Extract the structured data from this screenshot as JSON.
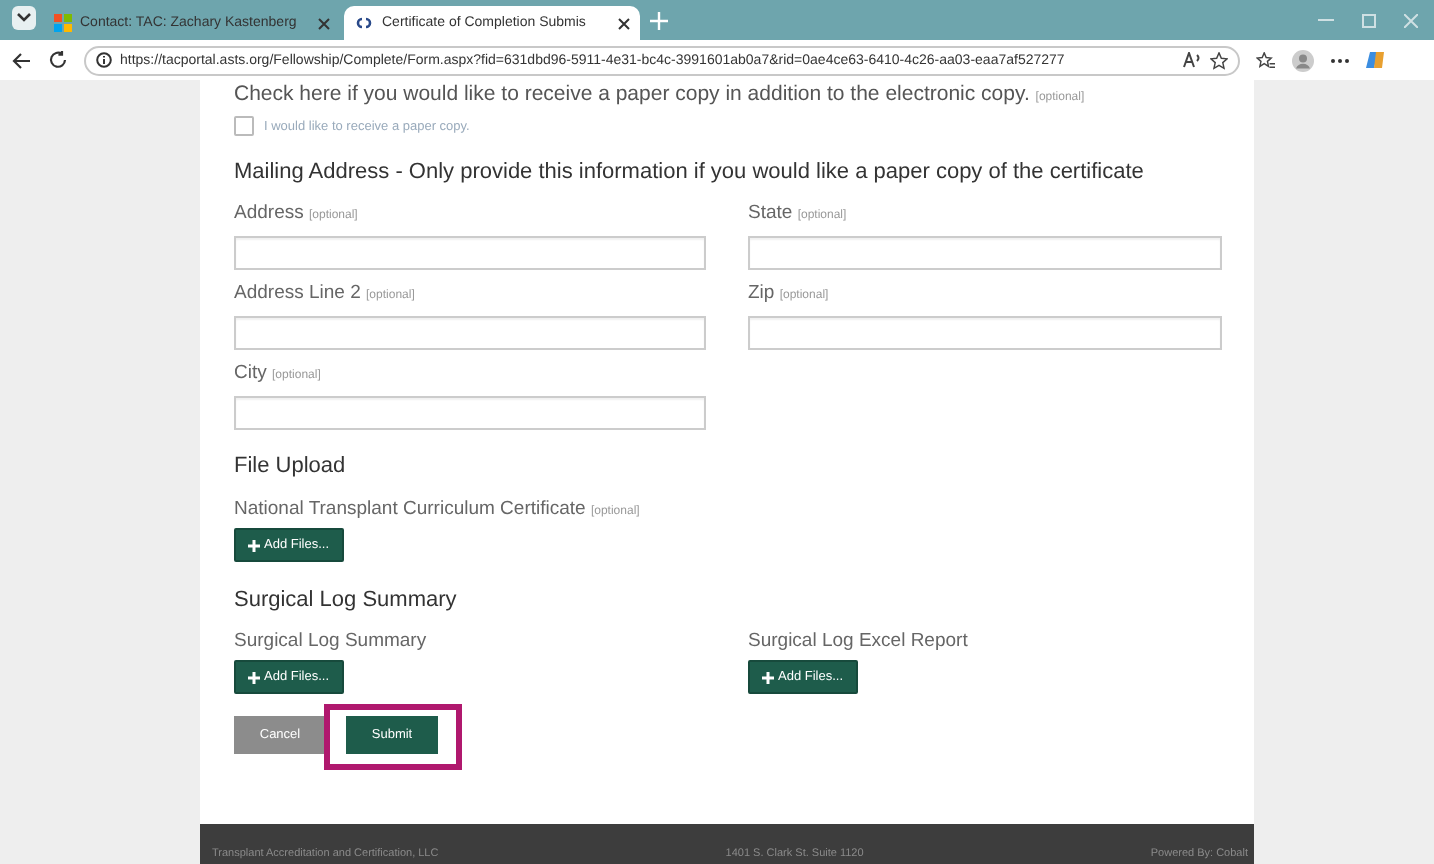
{
  "browser": {
    "tabs": [
      {
        "title": "Contact: TAC: Zachary Kastenberg",
        "selected": false
      },
      {
        "title": "Certificate of Completion Submis",
        "selected": true
      }
    ],
    "url": "https://tacportal.asts.org/Fellowship/Complete/Form.aspx?fid=631dbd96-5911-4e31-bc4c-3991601ab0a7&rid=0ae4ce63-6410-4c26-aa03-eaa7af527277"
  },
  "form": {
    "paper_copy": {
      "prompt": "Check here if you would like to receive a paper copy in addition to the electronic copy.",
      "optional": "[optional]",
      "checkbox_label": "I would like to receive a paper copy.",
      "checked": false
    },
    "mailing_heading": "Mailing Address - Only provide this information if you would like a paper copy of the certificate",
    "address_fields": [
      {
        "label": "Address",
        "optional": "[optional]"
      },
      {
        "label": "State",
        "optional": "[optional]"
      },
      {
        "label": "Address Line 2",
        "optional": "[optional]"
      },
      {
        "label": "Zip",
        "optional": "[optional]"
      },
      {
        "label": "City",
        "optional": "[optional]"
      }
    ],
    "file_upload": {
      "heading": "File Upload",
      "items": [
        {
          "label": "National Transplant Curriculum Certificate",
          "optional": "[optional]",
          "button": "Add Files..."
        }
      ]
    },
    "surgical_log": {
      "heading": "Surgical Log Summary",
      "items": [
        {
          "label": "Surgical Log Summary",
          "button": "Add Files..."
        },
        {
          "label": "Surgical Log Excel Report",
          "button": "Add Files..."
        }
      ]
    },
    "actions": [
      {
        "label": "Cancel",
        "kind": "secondary",
        "highlighted": false
      },
      {
        "label": "Submit",
        "kind": "primary",
        "highlighted": true
      }
    ]
  },
  "footer": {
    "company": "Transplant Accreditation and Certification, LLC",
    "address": "1401 S. Clark St. Suite 1120",
    "powered_by": "Powered By: Cobalt"
  }
}
